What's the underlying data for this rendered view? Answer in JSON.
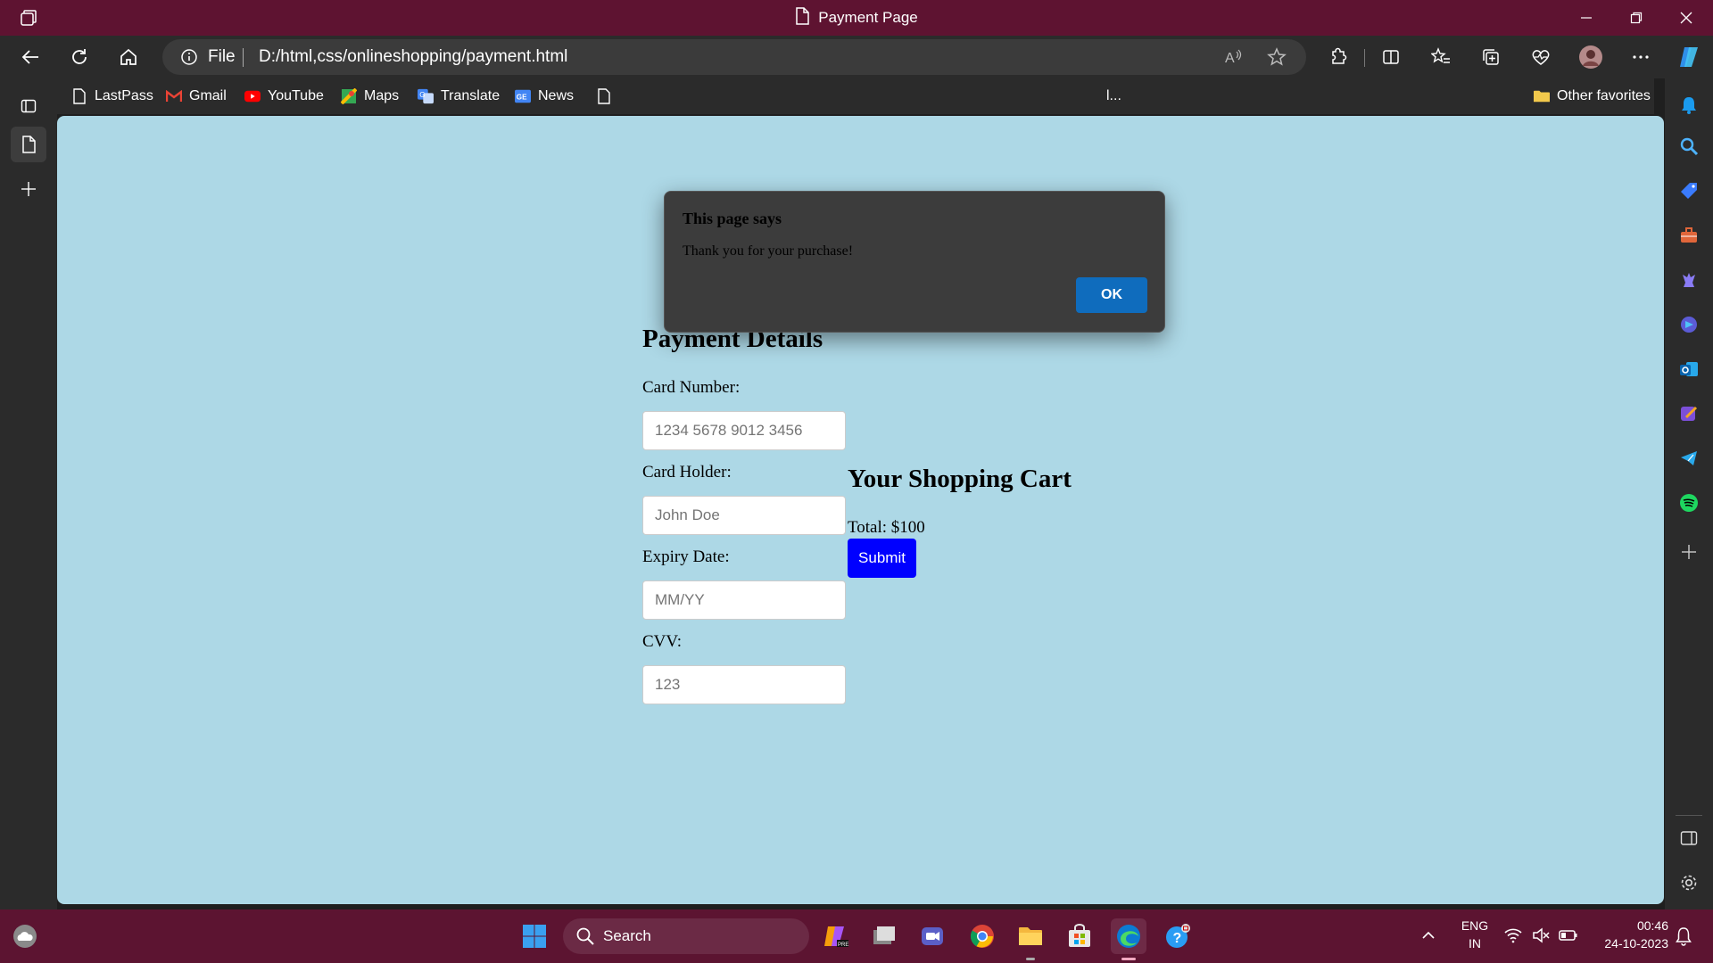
{
  "window": {
    "title": "Payment Page",
    "accent": "#5e1331"
  },
  "address_bar": {
    "file_label": "File",
    "url": "D:/html,css/onlineshopping/payment.html"
  },
  "favorites": {
    "items": [
      "LastPass",
      "Gmail",
      "YouTube",
      "Maps",
      "Translate",
      "News"
    ],
    "truncated_label": "l...",
    "other_favorites": "Other favorites"
  },
  "page": {
    "background": "#add8e6",
    "payment_title": "Payment Details",
    "fields": [
      {
        "label": "Card Number:",
        "placeholder": "1234 5678 9012 3456",
        "value": ""
      },
      {
        "label": "Card Holder:",
        "placeholder": "John Doe",
        "value": ""
      },
      {
        "label": "Expiry Date:",
        "placeholder": "MM/YY",
        "value": ""
      },
      {
        "label": "CVV:",
        "placeholder": "123",
        "value": ""
      }
    ],
    "cart_title": "Your Shopping Cart",
    "total": "Total: $100",
    "submit_label": "Submit",
    "submit_color": "#0000ff"
  },
  "dialog": {
    "title": "This page says",
    "message": "Thank you for your purchase!",
    "ok_label": "OK",
    "ok_color": "#0f6cbd"
  },
  "taskbar": {
    "search_label": "Search",
    "lang_line1": "ENG",
    "lang_line2": "IN",
    "time": "00:46",
    "date": "24-10-2023"
  },
  "icons": {
    "titlebar": [
      "tab-actions-icon",
      "page-icon",
      "minimize-icon",
      "restore-icon",
      "close-icon"
    ],
    "navbar": [
      "back-icon",
      "refresh-icon",
      "home-icon",
      "info-icon",
      "read-aloud-icon",
      "favorite-star-icon",
      "extensions-icon",
      "split-screen-icon",
      "favorites-icon",
      "collections-icon",
      "browser-essentials-icon",
      "profile-avatar",
      "more-icon",
      "copilot-icon"
    ],
    "sidebar": [
      "notifications-bell-icon",
      "search-icon",
      "shopping-tag-icon",
      "tools-icon",
      "games-icon",
      "copilot-app-icon",
      "outlook-icon",
      "designer-icon",
      "telegram-icon",
      "spotify-icon",
      "add-icon",
      "hide-sidebar-icon",
      "settings-icon"
    ],
    "taskbar": [
      "weather-icon",
      "windows-start-icon",
      "app-pre-icon",
      "app-files-icon",
      "teams-icon",
      "chrome-icon",
      "file-explorer-icon",
      "store-icon",
      "edge-icon",
      "help-icon",
      "chevron-up-icon",
      "wifi-icon",
      "volume-mute-icon",
      "battery-icon",
      "notification-icon"
    ]
  }
}
